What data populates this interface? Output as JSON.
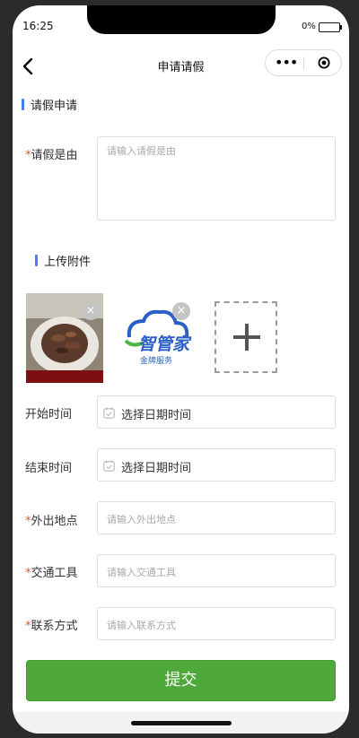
{
  "status_bar": {
    "time": "16:25",
    "battery_percent": "0%"
  },
  "nav": {
    "title": "申请请假",
    "more_label": "•••"
  },
  "leave_section": {
    "title": "请假申请"
  },
  "reason": {
    "label": "请假是由",
    "required_mark": "*",
    "placeholder": "请输入请假是由"
  },
  "attachments": {
    "title": "上传附件",
    "items": [
      {
        "type": "photo",
        "description_icon": "food-photo"
      },
      {
        "type": "logo",
        "logo_title": "智管家",
        "logo_subtitle": "金牌服务"
      }
    ],
    "close_glyph": "×"
  },
  "start_time": {
    "label": "开始时间",
    "value": "选择日期时间"
  },
  "end_time": {
    "label": "结束时间",
    "value": "选择日期时间"
  },
  "location": {
    "label": "外出地点",
    "required_mark": "*",
    "placeholder": "请输入外出地点"
  },
  "transport": {
    "label": "交通工具",
    "required_mark": "*",
    "placeholder": "请输入交通工具"
  },
  "contact": {
    "label": "联系方式",
    "required_mark": "*",
    "placeholder": "请输入联系方式"
  },
  "submit": {
    "label": "提交"
  },
  "colors": {
    "accent_bar": "#4a7df2",
    "submit_green": "#4ea93a",
    "required_red": "#e4572e",
    "logo_blue": "#2b5fc7",
    "logo_green": "#4cb543"
  }
}
